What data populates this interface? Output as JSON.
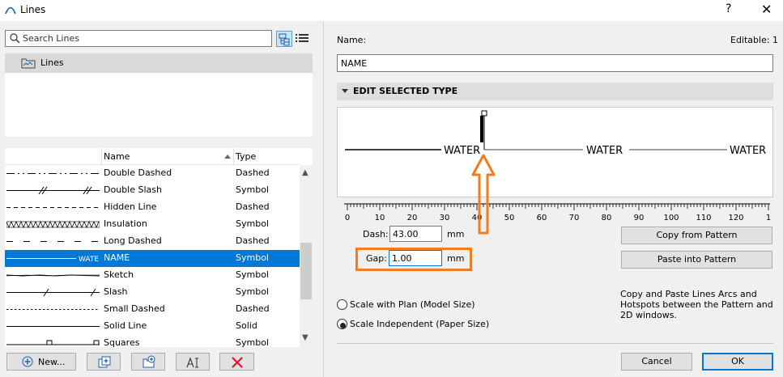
{
  "window": {
    "title": "Lines",
    "help": "?",
    "close": "✕"
  },
  "search": {
    "placeholder": "Search Lines"
  },
  "tree": {
    "root_label": "Lines"
  },
  "list": {
    "columns": {
      "name": "Name",
      "type": "Type"
    },
    "rows": [
      {
        "name": "Double Dashed",
        "type": "Dashed",
        "sample": "double-dashed"
      },
      {
        "name": "Double Slash",
        "type": "Symbol",
        "sample": "double-slash"
      },
      {
        "name": "Hidden Line",
        "type": "Dashed",
        "sample": "hidden"
      },
      {
        "name": "Insulation",
        "type": "Symbol",
        "sample": "insulation"
      },
      {
        "name": "Long Dashed",
        "type": "Dashed",
        "sample": "long-dashed"
      },
      {
        "name": "NAME",
        "type": "Symbol",
        "sample": "water",
        "selected": true,
        "sample_text": "WATE"
      },
      {
        "name": "Sketch",
        "type": "Symbol",
        "sample": "sketch"
      },
      {
        "name": "Slash",
        "type": "Symbol",
        "sample": "slash"
      },
      {
        "name": "Small Dashed",
        "type": "Dashed",
        "sample": "small-dashed"
      },
      {
        "name": "Solid Line",
        "type": "Solid",
        "sample": "solid"
      },
      {
        "name": "Squares",
        "type": "Symbol",
        "sample": "squares"
      }
    ]
  },
  "bottom_buttons": {
    "new_label": "New..."
  },
  "editor": {
    "name_label": "Name:",
    "editable_label": "Editable: 1",
    "name_value": "NAME",
    "section_title": "EDIT SELECTED TYPE",
    "preview_words": [
      "WATER",
      "WATER",
      "WATER"
    ],
    "ruler_labels": [
      "0",
      "10",
      "20",
      "30",
      "40",
      "50",
      "60",
      "70",
      "80",
      "90",
      "100",
      "110",
      "120",
      "1"
    ],
    "dash_label": "Dash:",
    "dash_value": "43.00",
    "dash_unit": "mm",
    "gap_label": "Gap:",
    "gap_value": "1.00",
    "gap_unit": "mm",
    "copy_button": "Copy from Pattern",
    "paste_button": "Paste into Pattern",
    "info_text": "Copy and Paste Lines Arcs and Hotspots between the Pattern and 2D windows.",
    "scale_plan": "Scale with Plan (Model Size)",
    "scale_independent": "Scale Independent (Paper Size)",
    "scale_selected": "independent",
    "cancel_button": "Cancel",
    "ok_button": "OK"
  },
  "colors": {
    "selection": "#0078d7",
    "highlight_annotation": "#f47c20"
  }
}
